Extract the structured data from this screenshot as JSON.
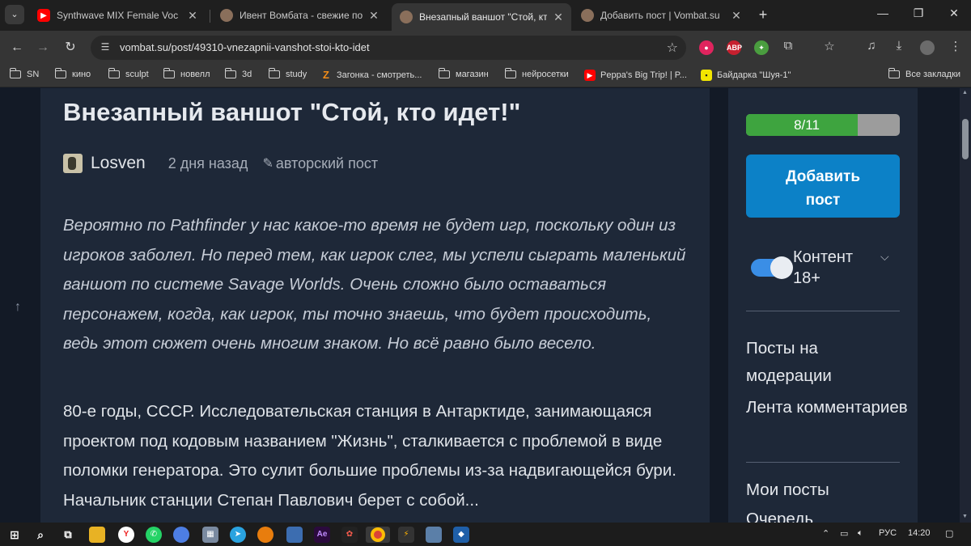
{
  "browser": {
    "tabs": [
      {
        "title": "Synthwave MIX Female Voc",
        "favicon": "youtube-icon",
        "active": false
      },
      {
        "title": "Ивент Вомбата - свежие пост",
        "favicon": "wombat-icon",
        "active": false
      },
      {
        "title": "Внезапный ваншот \"Стой, кто",
        "favicon": "wombat-icon",
        "active": true
      },
      {
        "title": "Добавить пост | Vombat.su",
        "favicon": "wombat-icon",
        "active": false
      }
    ],
    "url": "vombat.su/post/49310-vnezapnii-vanshot-stoi-kto-idet",
    "extensions": [
      {
        "name": "record-icon",
        "label": "",
        "color": "#e0245e"
      },
      {
        "name": "adblock-icon",
        "label": "ABP",
        "color": "#c7202f"
      },
      {
        "name": "colorpicker-icon",
        "label": "",
        "color": "#4a9d3f"
      },
      {
        "name": "extensions-icon",
        "label": "",
        "color": ""
      }
    ],
    "bookmarks": [
      {
        "label": "SN",
        "type": "folder"
      },
      {
        "label": "кино",
        "type": "folder"
      },
      {
        "label": "sculpt",
        "type": "folder"
      },
      {
        "label": "новелл",
        "type": "folder"
      },
      {
        "label": "3d",
        "type": "folder"
      },
      {
        "label": "study",
        "type": "folder"
      },
      {
        "label": "Загонка - смотреть...",
        "type": "link",
        "icon": "Z",
        "color": "#f28c18"
      },
      {
        "label": "магазин",
        "type": "folder"
      },
      {
        "label": "нейросетки",
        "type": "folder"
      },
      {
        "label": "Peppa's Big Trip! | P...",
        "type": "link",
        "icon": "▶",
        "color": "#ff0000"
      },
      {
        "label": "Байдарка \"Шуя-1\"",
        "type": "link",
        "icon": "▪",
        "color": "#f2e600"
      }
    ],
    "all_bookmarks": "Все закладки"
  },
  "post": {
    "title": "Внезапный ваншот \"Стой, кто идет!\"",
    "author": "Losven",
    "date": "2 дня назад",
    "kind": "авторский пост",
    "intro": "Вероятно по Pathfinder у нас какое-то время не будет игр, поскольку один из игроков заболел. Но перед тем, как игрок слег, мы успели сыграть маленький ваншот по системе Savage Worlds. Очень сложно было оставаться персонажем, когда, как игрок, ты точно знаешь, что будет происходить, ведь этот сюжет очень многим знаком. Но всё равно было весело.",
    "body": "80-е годы, СССР. Исследовательская станция в Антарктиде, занимающаяся проектом под кодовым названием \"Жизнь\", сталкивается с проблемой в виде поломки генератора. Это сулит большие проблемы из-за надвигающейся бури. Начальник станции Степан Павлович берет с собой..."
  },
  "sidebar": {
    "progress_label": "8/11",
    "progress_value": 8,
    "progress_total": 11,
    "add_post_line1": "Добавить",
    "add_post_line2": "пост",
    "toggle_label_line1": "Контент",
    "toggle_label_line2": "18+",
    "toggle_on": true,
    "links": [
      "Посты на модерации",
      "Лента комментариев",
      "Мои посты",
      "Очередь"
    ]
  },
  "taskbar": {
    "lang": "РУС",
    "time": "14:20"
  },
  "colors": {
    "page_bg": "#131a26",
    "card_bg": "#1e2838",
    "accent_blue": "#0c81c7",
    "progress_green": "#3ea43f"
  }
}
